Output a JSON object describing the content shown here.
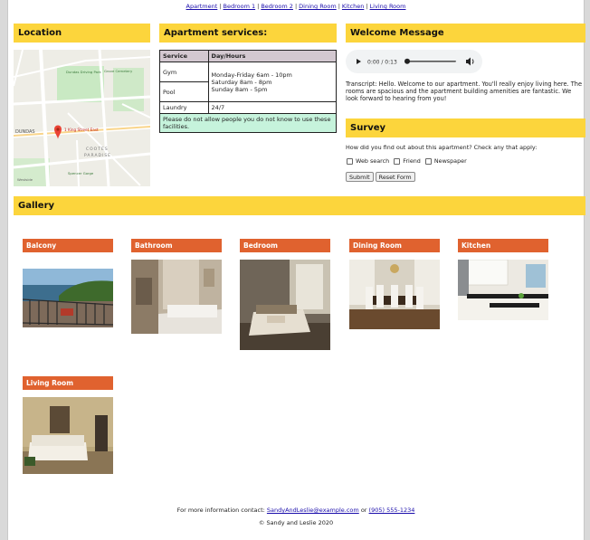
{
  "nav": {
    "links": [
      "Apartment",
      "Bedroom 1",
      "Bedroom 2",
      "Dining Room",
      "Kitchen",
      "Living Room"
    ],
    "separator": "|"
  },
  "location": {
    "heading": "Location",
    "map_labels": {
      "pin": "1 King Street East",
      "area1": "COOTES",
      "area2": "PARADISE",
      "street": "DUNDAS",
      "park": "Dundas Driving Park",
      "cemetery": "Grove Cemetery",
      "reserve": "Spencer Gorge",
      "westside": "Westside"
    }
  },
  "services": {
    "heading": "Apartment services:",
    "col1": "Service",
    "col2": "Day/Hours",
    "gym": "Gym",
    "pool": "Pool",
    "hours_line1": "Monday-Friday 6am - 10pm",
    "hours_line2": "Saturday 8am - 8pm",
    "hours_line3": "Sunday 8am - 5pm",
    "laundry": "Laundry",
    "laundry_hours": "24/7",
    "notice": "Please do not allow people you do not know to use these facilities."
  },
  "welcome": {
    "heading": "Welcome Message",
    "audio_time": "0:00 / 0:13",
    "transcript": "Transcript: Hello. Welcome to our apartment. You'll really enjoy living here. The rooms are spacious and the apartment building amenities are fantastic. We look forward to hearing from you!"
  },
  "survey": {
    "heading": "Survey",
    "question": "How did you find out about this apartment? Check any that apply:",
    "options": [
      "Web search",
      "Friend",
      "Newspaper"
    ],
    "submit": "Submit",
    "reset": "Reset Form"
  },
  "gallery": {
    "heading": "Gallery",
    "items": [
      "Balcony",
      "Bathroom",
      "Bedroom",
      "Dining Room",
      "Kitchen",
      "Living Room"
    ]
  },
  "footer": {
    "contact_prefix": "For more information contact:",
    "email": "SandyAndLeslie@example.com",
    "or": "or",
    "phone": "(905) 555-1234",
    "copyright": "© Sandy and Leslie 2020"
  },
  "colors": {
    "section_header": "#fcd53c",
    "gallery_header": "#e0622f",
    "table_header": "#d3c8d0",
    "notice_bg": "#c6f3dc"
  }
}
